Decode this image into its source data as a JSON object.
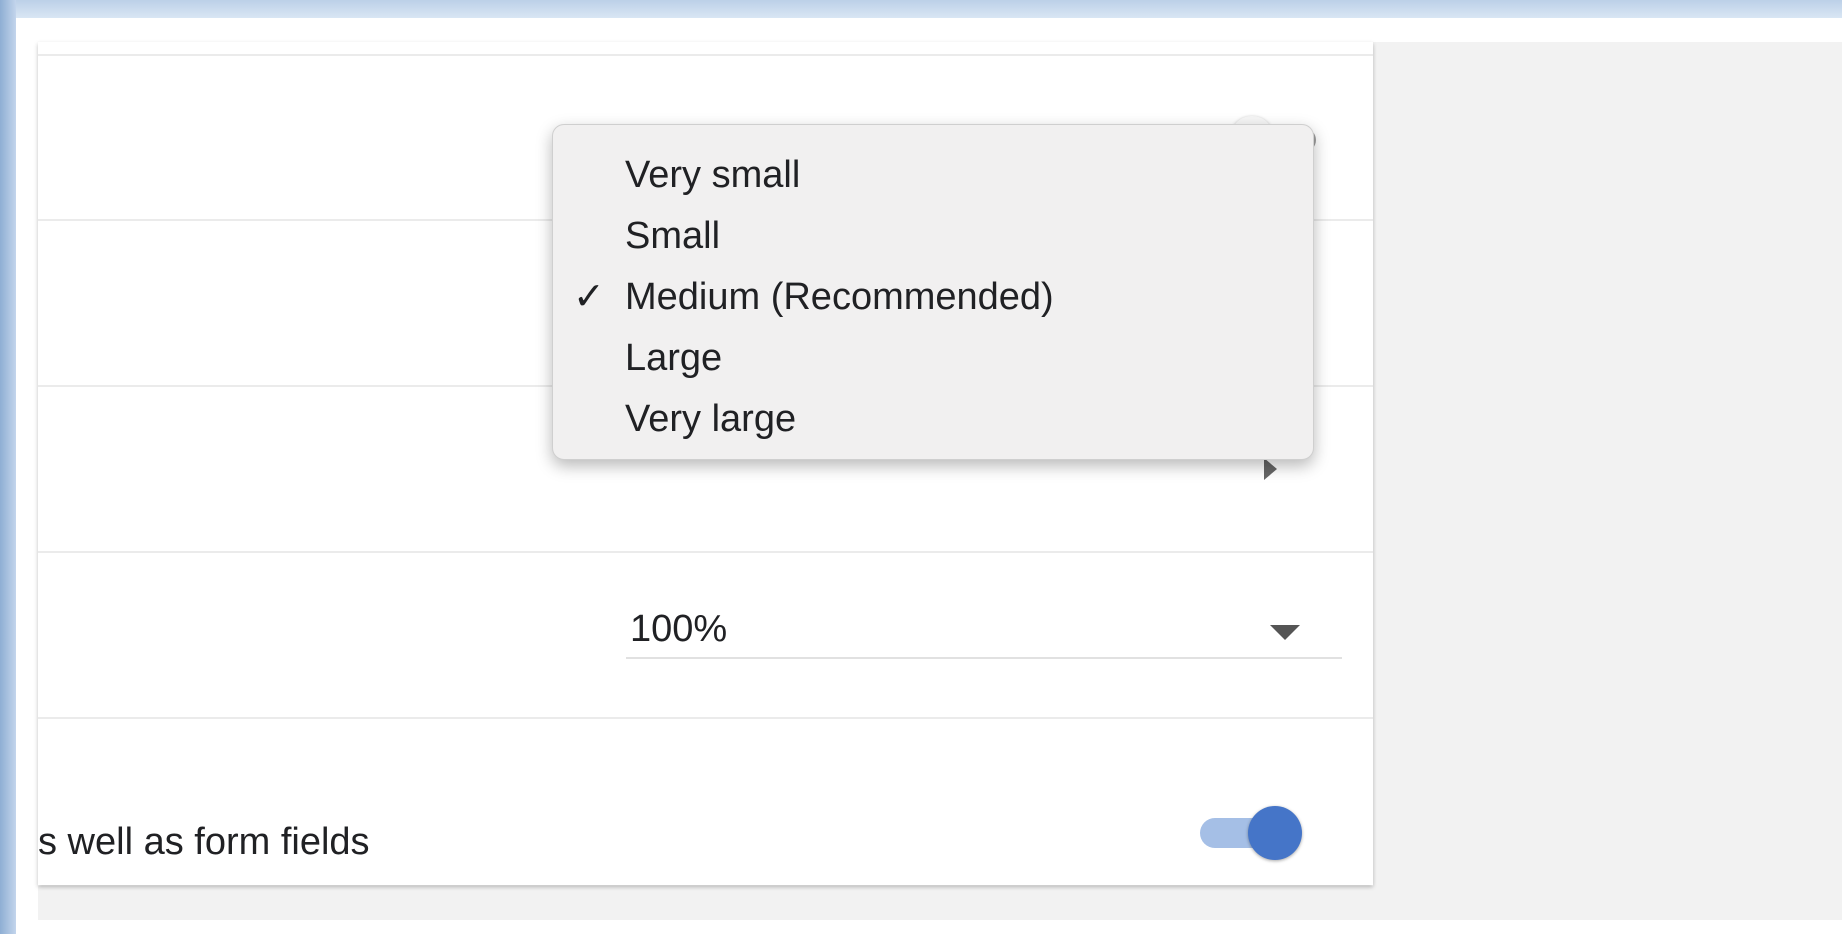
{
  "font_size_menu": {
    "items": [
      {
        "label": "Very small",
        "selected": false
      },
      {
        "label": "Small",
        "selected": false
      },
      {
        "label": "Medium (Recommended)",
        "selected": true
      },
      {
        "label": "Large",
        "selected": false
      },
      {
        "label": "Very large",
        "selected": false
      }
    ],
    "checkmark": "✓"
  },
  "page_zoom": {
    "value": "100%"
  },
  "form_fields_setting": {
    "label_fragment": "s well as form fields",
    "toggle_on": true
  },
  "colors": {
    "toggle_accent": "#4575c8",
    "toggle_track_on": "#a5bfe6",
    "menu_background": "#f1f0f0"
  }
}
